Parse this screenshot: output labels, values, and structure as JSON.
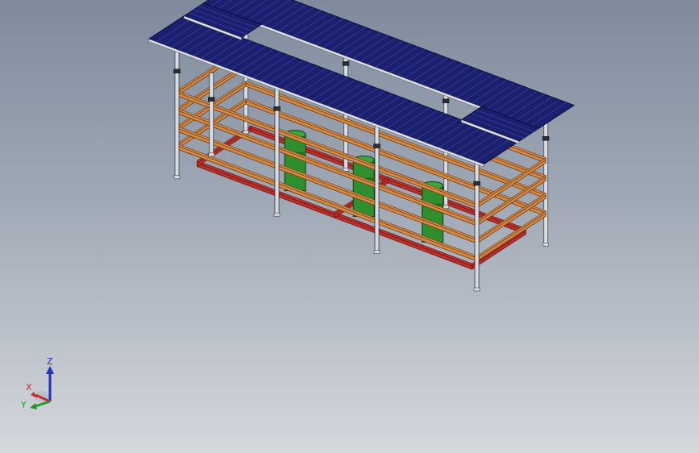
{
  "viewport": {
    "background_top": "#7f8b9d",
    "background_bottom": "#d5d8dd"
  },
  "model": {
    "roof_color": "#1a1f6e",
    "roof_edge_color": "#0b0f3d",
    "post_color": "#d9dde2",
    "post_edge_color": "#3a3f46",
    "rail_color": "#d58a45",
    "rail_edge_color": "#6b3a14",
    "base_color": "#c0302a",
    "base_edge_color": "#5e1410",
    "tank_color": "#2f8f2f",
    "tank_edge_color": "#0f3d10",
    "tank_count": 3
  },
  "triad": {
    "z_label": "Z",
    "x_label": "X",
    "y_label": "Y",
    "z_color": "#1f2fbf",
    "x_color": "#c03030",
    "y_color": "#1f9a2a"
  }
}
